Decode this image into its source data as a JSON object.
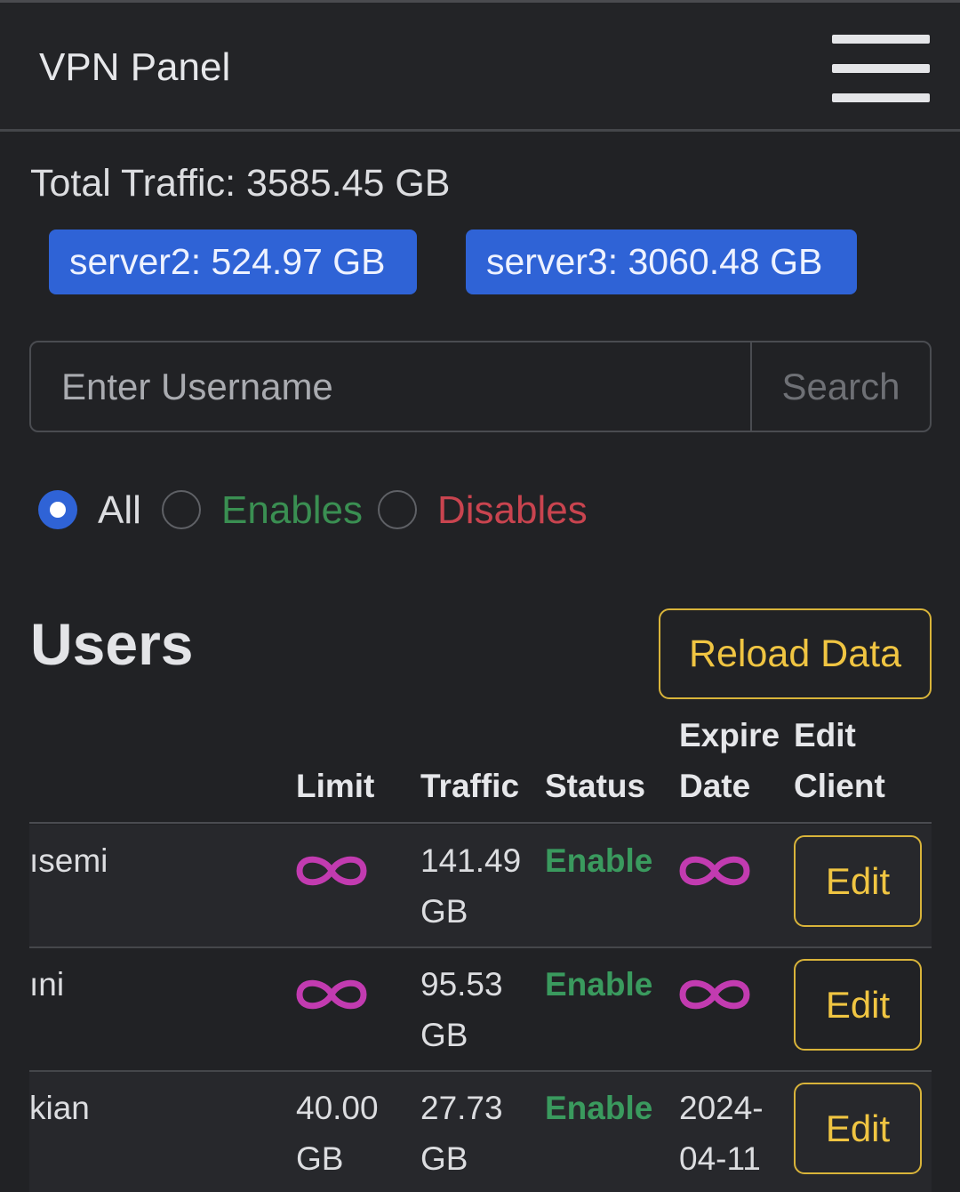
{
  "navbar": {
    "brand": "VPN Panel",
    "menu_icon": "hamburger-menu-icon"
  },
  "traffic": {
    "total": "Total Traffic: 3585.45 GB",
    "servers": [
      "server2: 524.97 GB",
      "server3: 3060.48 GB"
    ]
  },
  "search": {
    "placeholder": "Enter Username",
    "button_label": "Search"
  },
  "filters": {
    "options": [
      "All",
      "Enables",
      "Disables"
    ],
    "selected": "All",
    "colors": {
      "all": "#dcdde0",
      "enables": "#3a8f52",
      "disables": "#c9444f"
    }
  },
  "users": {
    "title": "Users",
    "reload_label": "Reload Data",
    "columns": {
      "limit": "Limit",
      "traffic": "Traffic",
      "status": "Status",
      "expire_1": "Expire",
      "expire_2": "Date",
      "edit_1": "Edit",
      "edit_2": "Client"
    },
    "rows": [
      {
        "name": "ısemi",
        "limit_icon": "infinity-icon",
        "traffic_1": "141.49",
        "traffic_2": "GB",
        "status": "Enable",
        "expire_icon": "infinity-icon",
        "edit_label": "Edit"
      },
      {
        "name": "ıni",
        "limit_icon": "infinity-icon",
        "traffic_1": "95.53",
        "traffic_2": "GB",
        "status": "Enable",
        "expire_icon": "infinity-icon",
        "edit_label": "Edit"
      },
      {
        "name": "kian",
        "limit_1": "40.00",
        "limit_2": "GB",
        "traffic_1": "27.73",
        "traffic_2": "GB",
        "status": "Enable",
        "expire_1": "2024-",
        "expire_2": "04-11",
        "edit_label": "Edit"
      }
    ],
    "colors": {
      "infinity": "#c23bb0",
      "status_enable": "#3a9a5e",
      "accent_warning": "#f0c542",
      "badge": "#2f63d6"
    }
  }
}
